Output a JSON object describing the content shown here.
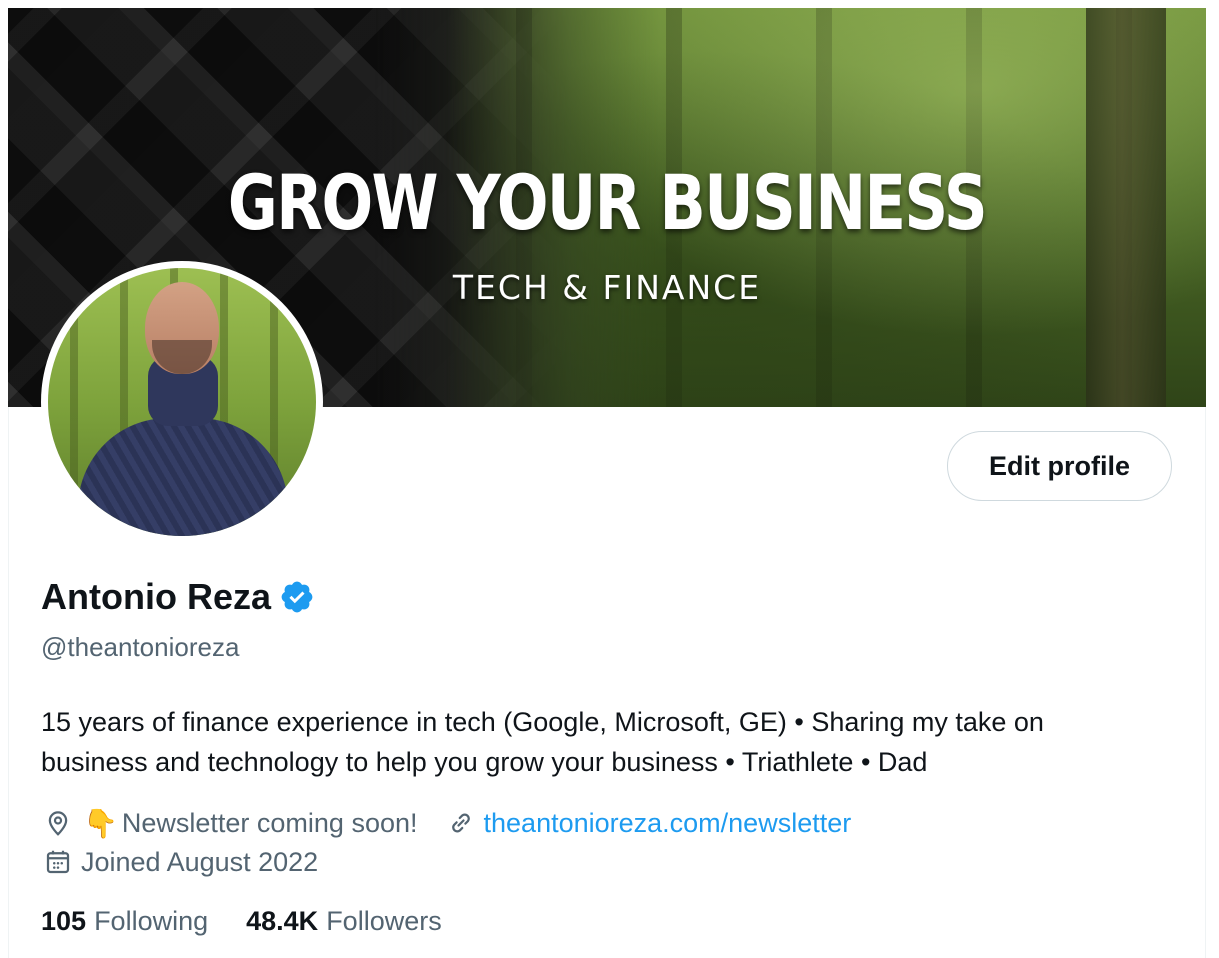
{
  "banner": {
    "title": "GROW YOUR BUSINESS",
    "subtitle": "TECH & FINANCE"
  },
  "profile": {
    "name": "Antonio Reza",
    "handle": "@theantonioreza",
    "verified_color": "#1d9bf0",
    "bio_lines": [
      "15 years of finance experience in tech (Google, Microsoft, GE) • Sharing my take on",
      "business and technology to help you grow your business • Triathlete • Dad"
    ],
    "location": "Newsletter coming soon!",
    "location_emoji": "👇",
    "website": "theantonioreza.com/newsletter",
    "joined": "Joined August 2022"
  },
  "actions": {
    "edit_profile_label": "Edit profile"
  },
  "stats": {
    "following_count": "105",
    "following_label": "Following",
    "followers_count": "48.4K",
    "followers_label": "Followers"
  },
  "icons": {
    "location": "location-pin-icon",
    "link": "link-icon",
    "calendar": "calendar-icon",
    "verified": "verified-badge-icon"
  }
}
